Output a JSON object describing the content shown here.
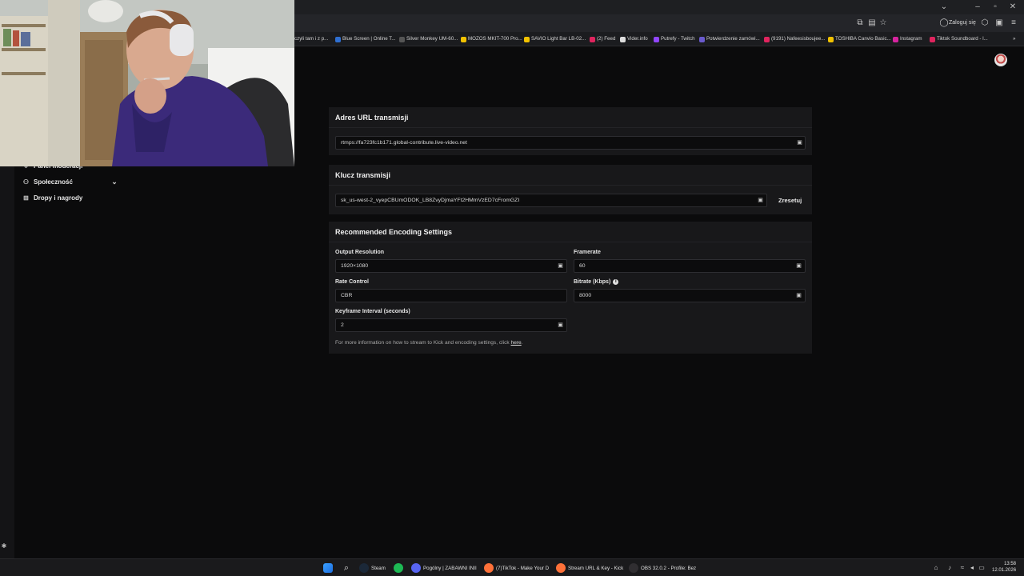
{
  "browser": {
    "login_label": "Zaloguj się",
    "bookmarks": [
      {
        "label": "czyli tam i z p...",
        "color": "#555"
      },
      {
        "label": "Blue Screen | Online T...",
        "color": "#2f6fd1"
      },
      {
        "label": "Silver Monkey UM-60...",
        "color": "#555"
      },
      {
        "label": "MOZOS MKIT-700 Pro...",
        "color": "#f2c200"
      },
      {
        "label": "SAVIO Light Bar LB-02...",
        "color": "#f2c200"
      },
      {
        "label": "(2) Feed",
        "color": "#e0245e"
      },
      {
        "label": "Vider.info",
        "color": "#dddddd"
      },
      {
        "label": "Putrefy - Twitch",
        "color": "#9146ff"
      },
      {
        "label": "Potwierdzenie zamówi...",
        "color": "#6a5acd"
      },
      {
        "label": "(9191) Nafeesisboujee...",
        "color": "#e0245e"
      },
      {
        "label": "TOSHIBA Canvio Basic...",
        "color": "#f2c200"
      },
      {
        "label": "Instagram",
        "color": "#d6249f"
      },
      {
        "label": "Tiktok Soundboard - l...",
        "color": "#e0245e"
      }
    ]
  },
  "sidebar": {
    "items": [
      {
        "label": "Panel moderacji",
        "icon": "shield-icon"
      },
      {
        "label": "Społeczność",
        "icon": "community-icon"
      },
      {
        "label": "Dropy i nagrody",
        "icon": "gift-icon"
      }
    ]
  },
  "stream_url": {
    "title": "Adres URL transmisji",
    "value": "rtmps://fa723fc1b171.global-contribute.live-video.net"
  },
  "stream_key": {
    "title": "Klucz transmisji",
    "value": "sk_us-west-2_vyepCBUmODOK_LB8ZvyDjmaYFt2HMmVzED7cFromGZI",
    "reset_label": "Zresetuj"
  },
  "encoding": {
    "title": "Recommended Encoding Settings",
    "output_resolution_label": "Output Resolution",
    "output_resolution_value": "1920×1080",
    "framerate_label": "Framerate",
    "framerate_value": "60",
    "rate_control_label": "Rate Control",
    "rate_control_value": "CBR",
    "bitrate_label": "Bitrate (Kbps)",
    "bitrate_value": "8000",
    "keyframe_label": "Keyframe Interval (seconds)",
    "keyframe_value": "2",
    "note_text": "For more information on how to stream to Kick and encoding settings, click ",
    "note_link": "here",
    "note_end": "."
  },
  "taskbar": {
    "items": [
      {
        "label": "Steam",
        "color": "#1b2838"
      },
      {
        "label": "",
        "color": "#1db954"
      },
      {
        "label": "Pogólny | ZABAWNI INII",
        "color": "#5865f2"
      },
      {
        "label": "(7)TikTok - Make Your D",
        "color": "#ff7139"
      },
      {
        "label": "Stream URL & Key - Kick",
        "color": "#ff7139"
      },
      {
        "label": "OBS 32.0.2 - Profile: Bez",
        "color": "#302e31"
      }
    ],
    "time": "13:58",
    "date": "12.01.2026"
  }
}
